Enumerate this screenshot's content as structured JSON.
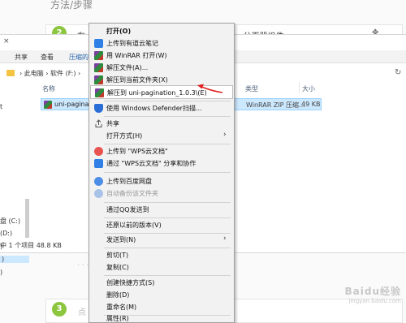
{
  "article": {
    "heading": "方法/步骤",
    "step2_number": "2",
    "step2_text_left": "在",
    "step2_text_right": "n 分页器组件",
    "step3_number": "3",
    "step3_text": "点",
    "dots": "· · · · ·",
    "watermark_brand": "Baidu经验",
    "watermark_url": "jingyan.baidu.com"
  },
  "explorer": {
    "close_glyph": "×",
    "ribbon_tabs": [
      {
        "label": "共享"
      },
      {
        "label": "查看"
      },
      {
        "label": "压缩的"
      }
    ],
    "address_crumbs": "›  此电脑  ›  软件 (F:)  ›",
    "refresh_glyph": "↻",
    "columns": {
      "name": "名称",
      "type": "类型",
      "size": "大小"
    },
    "file": {
      "name": "uni-pagination",
      "type": "WinRAR ZIP 压缩...",
      "size": "49 KB"
    },
    "nav_items": [
      {
        "label": "t"
      },
      {
        "label": "盘 (C:)"
      },
      {
        "label": "(D:)"
      },
      {
        "label": ")"
      },
      {
        "label": ")"
      },
      {
        "label": ")"
      }
    ],
    "status": "中 1 个项目  48.8 KB"
  },
  "menu": {
    "items": [
      {
        "label": "打开(O)",
        "icon": "none",
        "bold": true
      },
      {
        "label": "上传到有道云笔记",
        "icon": "note-icon"
      },
      {
        "label": "用 WinRAR 打开(W)",
        "icon": "winrar-icon"
      },
      {
        "label": "解压文件(A)...",
        "icon": "winrar-icon"
      },
      {
        "label": "解压到当前文件夹(X)",
        "icon": "winrar-icon"
      },
      {
        "label": "解压到 uni-pagination_1.0.3\\(E)",
        "icon": "winrar-icon",
        "highlighted": true
      },
      {
        "label": "使用 Windows Defender扫描...",
        "icon": "shield-icon"
      },
      {
        "label": "共享",
        "icon": "share-icon"
      },
      {
        "label": "打开方式(H)",
        "icon": "none",
        "submenu": true
      },
      {
        "label": "上传到 \"WPS云文档\"",
        "icon": "wps-cloud-icon"
      },
      {
        "label": "通过 \"WPS云文档\" 分享和协作",
        "icon": "wps-share-icon"
      },
      {
        "label": "上传到百度网盘",
        "icon": "baidu-netdisk-icon"
      },
      {
        "label": "自动备份该文件夹",
        "icon": "baidu-backup-icon",
        "disabled": true
      },
      {
        "label": "通过QQ发送到",
        "icon": "none"
      },
      {
        "label": "还原以前的版本(V)",
        "icon": "none"
      },
      {
        "label": "发送到(N)",
        "icon": "none",
        "submenu": true
      },
      {
        "label": "剪切(T)",
        "icon": "none"
      },
      {
        "label": "复制(C)",
        "icon": "none"
      },
      {
        "label": "创建快捷方式(S)",
        "icon": "none"
      },
      {
        "label": "删除(D)",
        "icon": "none"
      },
      {
        "label": "重命名(M)",
        "icon": "none"
      },
      {
        "label": "属性(R)",
        "icon": "none"
      }
    ],
    "submenu_glyph": "›"
  },
  "colors": {
    "accent_green": "#8cc63f",
    "selection_blue": "#cce8ff",
    "annotation_red": "#e02020"
  }
}
